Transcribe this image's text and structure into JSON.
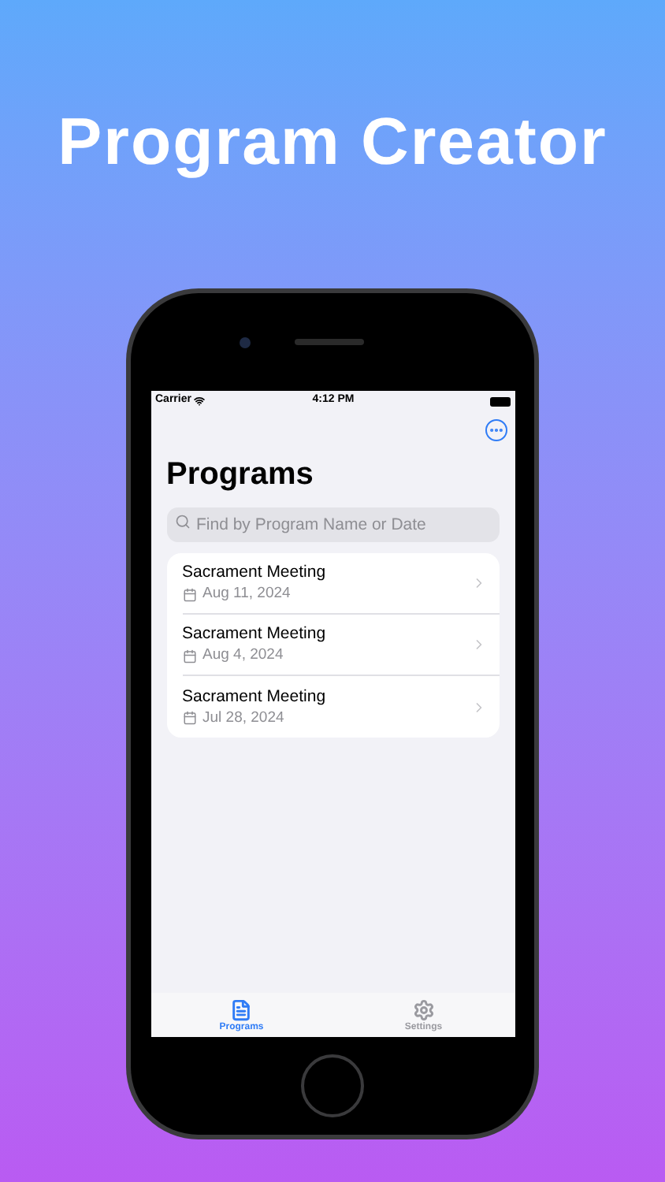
{
  "headline": "Program Creator",
  "status_bar": {
    "carrier": "Carrier",
    "time": "4:12 PM"
  },
  "title": "Programs",
  "search": {
    "placeholder": "Find by Program Name or Date"
  },
  "programs": [
    {
      "name": "Sacrament Meeting",
      "date": "Aug 11, 2024"
    },
    {
      "name": "Sacrament Meeting",
      "date": "Aug 4, 2024"
    },
    {
      "name": "Sacrament Meeting",
      "date": "Jul 28, 2024"
    }
  ],
  "tabs": [
    {
      "label": "Programs",
      "kind": "programs",
      "selected": true
    },
    {
      "label": "Settings",
      "kind": "settings",
      "selected": false
    }
  ]
}
